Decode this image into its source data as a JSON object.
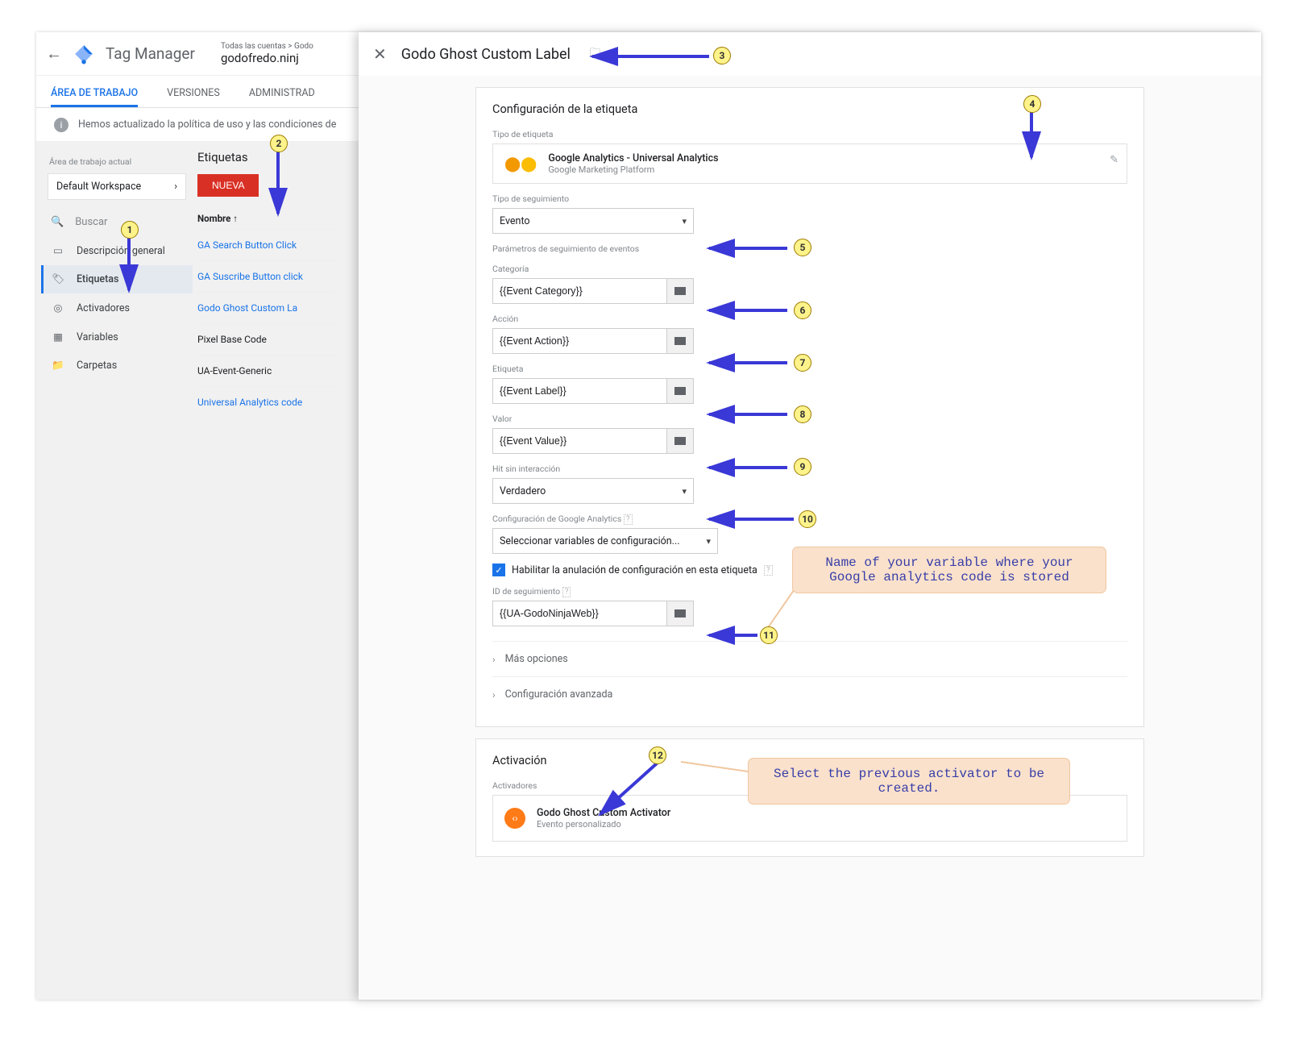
{
  "app": {
    "product": "Tag Manager",
    "breadcrumb_top": "Todas las cuentas > Godo",
    "breadcrumb_main": "godofredo.ninj",
    "tabs": [
      "ÁREA DE TRABAJO",
      "VERSIONES",
      "ADMINISTRAD"
    ],
    "notice": "Hemos actualizado la política de uso y las condiciones de",
    "workspace_label": "Área de trabajo actual",
    "workspace_name": "Default Workspace",
    "search_placeholder": "Buscar",
    "nav": {
      "overview": "Descripción general",
      "tags": "Etiquetas",
      "triggers": "Activadores",
      "variables": "Variables",
      "folders": "Carpetas"
    }
  },
  "tags_col": {
    "heading": "Etiquetas",
    "new_btn": "NUEVA",
    "name_col": "Nombre ↑",
    "rows": [
      "GA Search Button Click",
      "GA Suscribe Button click",
      "Godo Ghost Custom La",
      "Pixel Base Code",
      "UA-Event-Generic",
      "Universal Analytics code"
    ]
  },
  "panel": {
    "title": "Godo Ghost Custom Label",
    "config_h": "Configuración de la etiqueta",
    "type_lbl": "Tipo de etiqueta",
    "tag_type_line1": "Google Analytics - Universal Analytics",
    "tag_type_line2": "Google Marketing Platform",
    "track_type_lbl": "Tipo de seguimiento",
    "track_type_val": "Evento",
    "params_lbl": "Parámetros de seguimiento de eventos",
    "cat_lbl": "Categoría",
    "cat_val": "{{Event Category}}",
    "act_lbl": "Acción",
    "act_val": "{{Event Action}}",
    "etq_lbl": "Etiqueta",
    "etq_val": "{{Event Label}}",
    "val_lbl": "Valor",
    "val_val": "{{Event Value}}",
    "hit_lbl": "Hit sin interacción",
    "hit_val": "Verdadero",
    "gaconf_lbl": "Configuración de Google Analytics",
    "gaconf_val": "Seleccionar variables de configuración...",
    "override_cb": "Habilitar la anulación de configuración en esta etiqueta",
    "trackid_lbl": "ID de seguimiento",
    "trackid_val": "{{UA-GodoNinjaWeb}}",
    "more_opts": "Más opciones",
    "adv_conf": "Configuración avanzada",
    "activation_h": "Activación",
    "activators_lbl": "Activadores",
    "trigger_name": "Godo Ghost Custom Activator",
    "trigger_sub": "Evento personalizado"
  },
  "annotations": {
    "bubble1": "Name of your variable where your\nGoogle analytics code is stored",
    "bubble2": "Select the previous activator to\nbe created."
  }
}
